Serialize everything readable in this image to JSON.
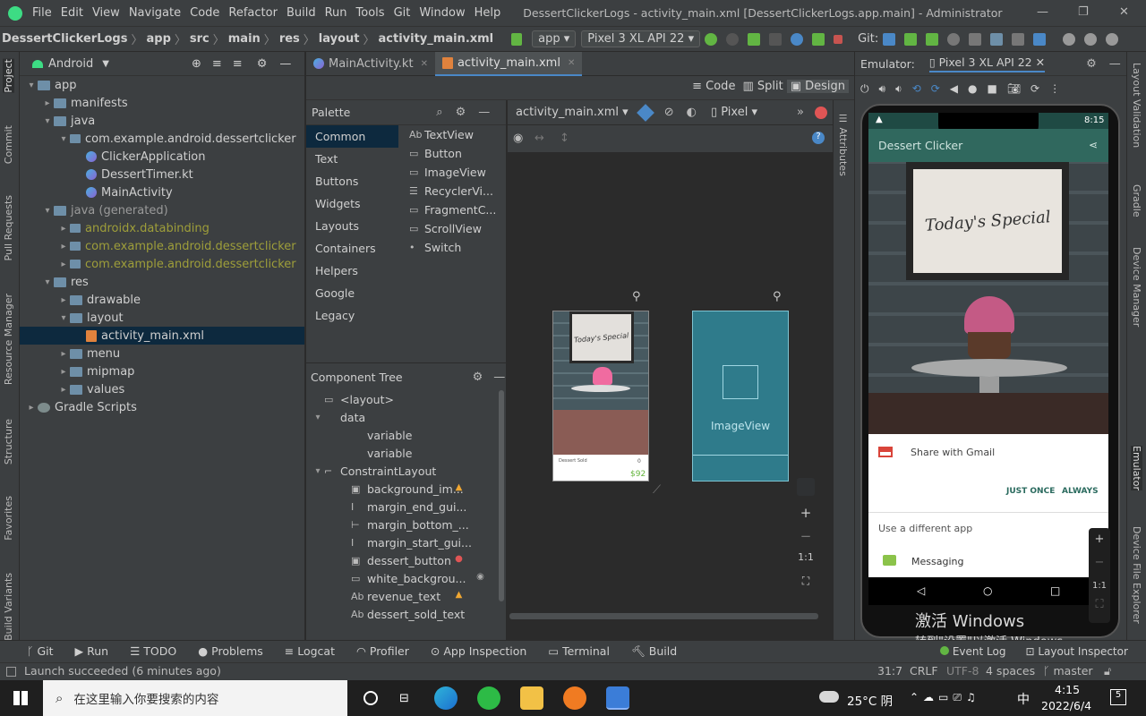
{
  "menubar": {
    "items": [
      "File",
      "Edit",
      "View",
      "Navigate",
      "Code",
      "Refactor",
      "Build",
      "Run",
      "Tools",
      "Git",
      "Window",
      "Help"
    ],
    "title": "DessertClickerLogs - activity_main.xml [DessertClickerLogs.app.main] - Administrator"
  },
  "navbar": {
    "breadcrumbs": [
      "DessertClickerLogs",
      "app",
      "src",
      "main",
      "res",
      "layout",
      "activity_main.xml"
    ],
    "run_config": "app",
    "device": "Pixel 3 XL API 22",
    "git_label": "Git:"
  },
  "side_tabs": {
    "left": [
      "Project",
      "Commit",
      "Pull Requests",
      "Resource Manager",
      "Structure",
      "Favorites",
      "Build Variants"
    ],
    "right": [
      "Layout Validation",
      "Gradle",
      "Device Manager",
      "Emulator",
      "Device File Explorer"
    ]
  },
  "project": {
    "view": "Android",
    "tree": [
      {
        "label": "app",
        "depth": 0,
        "arrow": "▾",
        "icon": "folder"
      },
      {
        "label": "manifests",
        "depth": 1,
        "arrow": "▸",
        "icon": "folder"
      },
      {
        "label": "java",
        "depth": 1,
        "arrow": "▾",
        "icon": "folder"
      },
      {
        "label": "com.example.android.dessertclicker",
        "depth": 2,
        "arrow": "▾",
        "icon": "pkg"
      },
      {
        "label": "ClickerApplication",
        "depth": 3,
        "arrow": "",
        "icon": "kt"
      },
      {
        "label": "DessertTimer.kt",
        "depth": 3,
        "arrow": "",
        "icon": "kt"
      },
      {
        "label": "MainActivity",
        "depth": 3,
        "arrow": "",
        "icon": "kt"
      },
      {
        "label": "java (generated)",
        "depth": 1,
        "arrow": "▾",
        "icon": "folder",
        "muted": true
      },
      {
        "label": "androidx.databinding",
        "depth": 2,
        "arrow": "▸",
        "icon": "pkg",
        "gen": true
      },
      {
        "label": "com.example.android.dessertclicker",
        "depth": 2,
        "arrow": "▸",
        "icon": "pkg",
        "gen": true
      },
      {
        "label": "com.example.android.dessertclicker",
        "depth": 2,
        "arrow": "▸",
        "icon": "pkg",
        "gen": true
      },
      {
        "label": "res",
        "depth": 1,
        "arrow": "▾",
        "icon": "folder"
      },
      {
        "label": "drawable",
        "depth": 2,
        "arrow": "▸",
        "icon": "folder"
      },
      {
        "label": "layout",
        "depth": 2,
        "arrow": "▾",
        "icon": "folder"
      },
      {
        "label": "activity_main.xml",
        "depth": 3,
        "arrow": "",
        "icon": "xml",
        "selected": true
      },
      {
        "label": "menu",
        "depth": 2,
        "arrow": "▸",
        "icon": "folder"
      },
      {
        "label": "mipmap",
        "depth": 2,
        "arrow": "▸",
        "icon": "folder"
      },
      {
        "label": "values",
        "depth": 2,
        "arrow": "▸",
        "icon": "folder"
      },
      {
        "label": "Gradle Scripts",
        "depth": 0,
        "arrow": "▸",
        "icon": "gradle"
      }
    ]
  },
  "editor_tabs": [
    {
      "label": "MainActivity.kt",
      "active": false
    },
    {
      "label": "activity_main.xml",
      "active": true
    }
  ],
  "modes": [
    "Code",
    "Split",
    "Design"
  ],
  "palette": {
    "title": "Palette",
    "categories": [
      "Common",
      "Text",
      "Buttons",
      "Widgets",
      "Layouts",
      "Containers",
      "Helpers",
      "Google",
      "Legacy"
    ],
    "items": [
      "TextView",
      "Button",
      "ImageView",
      "RecyclerVi...",
      "FragmentC...",
      "ScrollView",
      "Switch"
    ],
    "item_icons": [
      "Ab",
      "▭",
      "▭",
      "☰",
      "▭",
      "▭",
      "•"
    ]
  },
  "component_tree": {
    "title": "Component Tree",
    "rows": [
      {
        "label": "<layout>",
        "depth": 0,
        "arrow": "",
        "icon": "▭"
      },
      {
        "label": "data",
        "depth": 0,
        "arrow": "▾",
        "icon": ""
      },
      {
        "label": "variable",
        "depth": 1,
        "arrow": "",
        "icon": ""
      },
      {
        "label": "variable",
        "depth": 1,
        "arrow": "",
        "icon": ""
      },
      {
        "label": "ConstraintLayout",
        "depth": 0,
        "arrow": "▾",
        "icon": "⌐"
      },
      {
        "label": "background_im...",
        "depth": 1,
        "arrow": "",
        "icon": "▣",
        "badge": "warn"
      },
      {
        "label": "margin_end_gui...",
        "depth": 1,
        "arrow": "",
        "icon": "I"
      },
      {
        "label": "margin_bottom_...",
        "depth": 1,
        "arrow": "",
        "icon": "⊢"
      },
      {
        "label": "margin_start_gui...",
        "depth": 1,
        "arrow": "",
        "icon": "I"
      },
      {
        "label": "dessert_button",
        "depth": 1,
        "arrow": "",
        "icon": "▣",
        "badge": "error"
      },
      {
        "label": "white_backgrou...",
        "depth": 1,
        "arrow": "",
        "icon": "▭",
        "badge": "eye"
      },
      {
        "label": "revenue_text",
        "depth": 1,
        "arrow": "",
        "icon": "Ab",
        "badge": "warn"
      },
      {
        "label": "dessert_sold_text",
        "depth": 1,
        "arrow": "",
        "icon": "Ab"
      }
    ]
  },
  "design_toolbar": {
    "file_select": "activity_main.xml",
    "device_select": "Pixel",
    "zoom_controls": [
      "+",
      "−",
      "1:1"
    ]
  },
  "preview": {
    "special_text": "Today's Special",
    "sold_label": "Dessert Sold",
    "sold_value": "0",
    "revenue": "$92",
    "blueprint_label": "ImageView"
  },
  "emulator": {
    "tab_label": "Emulator:",
    "device_tab": "Pixel 3 XL API 22",
    "status_time": "8:15",
    "app_title": "Dessert Clicker",
    "special_text": "Today's Special",
    "share_option": "Share with Gmail",
    "just_once": "JUST ONCE",
    "always": "ALWAYS",
    "different_app": "Use a different app",
    "messaging": "Messaging",
    "zoom_controls": [
      "+",
      "−",
      "1:1"
    ]
  },
  "watermark": {
    "line1": "激活 Windows",
    "line2": "转到\"设置\"以激活 Windows。"
  },
  "bottom_tabs": [
    "Git",
    "Run",
    "TODO",
    "Problems",
    "Logcat",
    "Profiler",
    "App Inspection",
    "Terminal",
    "Build"
  ],
  "bottom_right_tabs": [
    "Event Log",
    "Layout Inspector"
  ],
  "status": {
    "message": "Launch succeeded (6 minutes ago)",
    "position": "31:7",
    "line_sep": "CRLF",
    "encoding": "UTF-8",
    "indent": "4 spaces",
    "branch": "master"
  },
  "taskbar": {
    "search_placeholder": "在这里输入你要搜索的内容",
    "weather": "25°C 阴",
    "ime": "中",
    "time": "4:15",
    "date": "2022/6/4",
    "notifications": "5"
  },
  "colors": {
    "accent": "#4a88c7",
    "selection": "#0d293e",
    "emulator_toolbar": "#30685e",
    "warning": "#f0a732",
    "error": "#e05555"
  }
}
